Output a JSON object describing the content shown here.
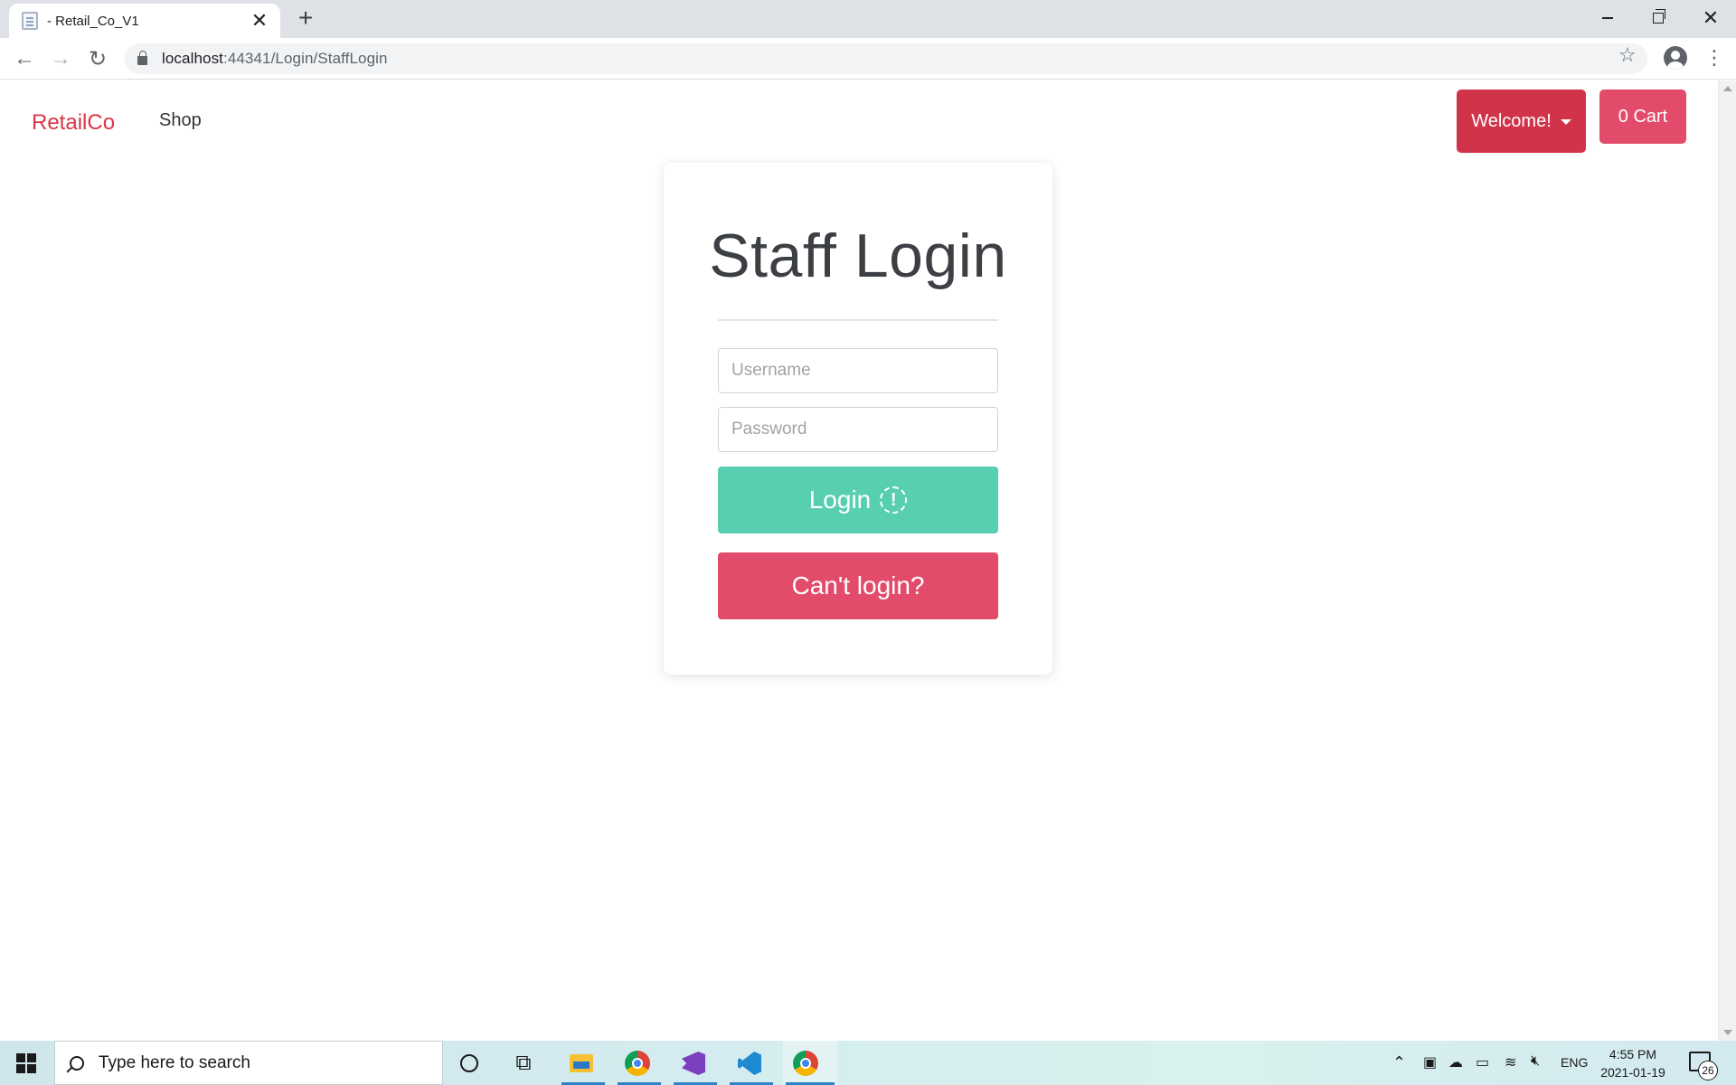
{
  "browser": {
    "tab_title": "- Retail_Co_V1",
    "tab_close": "✕",
    "new_tab": "+",
    "url_host": "localhost",
    "url_rest": ":44341/Login/StaffLogin"
  },
  "navbar": {
    "brand": "RetailCo",
    "shop": "Shop",
    "welcome": "Welcome!",
    "cart": "0 Cart"
  },
  "login_card": {
    "title": "Staff Login",
    "username_placeholder": "Username",
    "password_placeholder": "Password",
    "login_label": "Login",
    "login_icon_glyph": "!",
    "cant_login_label": "Can't login?"
  },
  "taskbar": {
    "search_placeholder": "Type here to search",
    "language": "ENG",
    "time": "4:55 PM",
    "date": "2021-01-19",
    "notification_count": "26"
  },
  "colors": {
    "brand": "#dc3545",
    "login_button": "#57cfb0",
    "cant_login_button": "#e34b6b",
    "welcome_button": "#d1334a"
  }
}
